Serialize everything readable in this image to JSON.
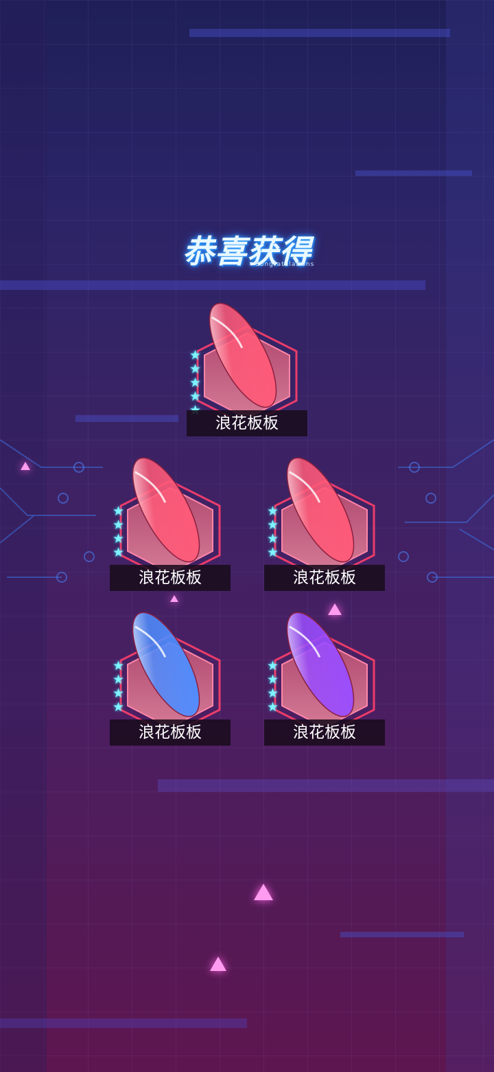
{
  "header": {
    "title": "恭喜获得",
    "subtitle": "Congratulations"
  },
  "rewards": [
    {
      "name": "浪花板板",
      "stars": 5,
      "color": "#ff5a78"
    },
    {
      "name": "浪花板板",
      "stars": 4,
      "color": "#ff5a78"
    },
    {
      "name": "浪花板板",
      "stars": 4,
      "color": "#ff5a78"
    },
    {
      "name": "浪花板板",
      "stars": 4,
      "color": "#4f8dff"
    },
    {
      "name": "浪花板板",
      "stars": 4,
      "color": "#9a4dff"
    }
  ],
  "theme": {
    "frame_color": "#ff3f6a",
    "star_color": "#7ff3ff",
    "accent": "#2fa6ff"
  }
}
